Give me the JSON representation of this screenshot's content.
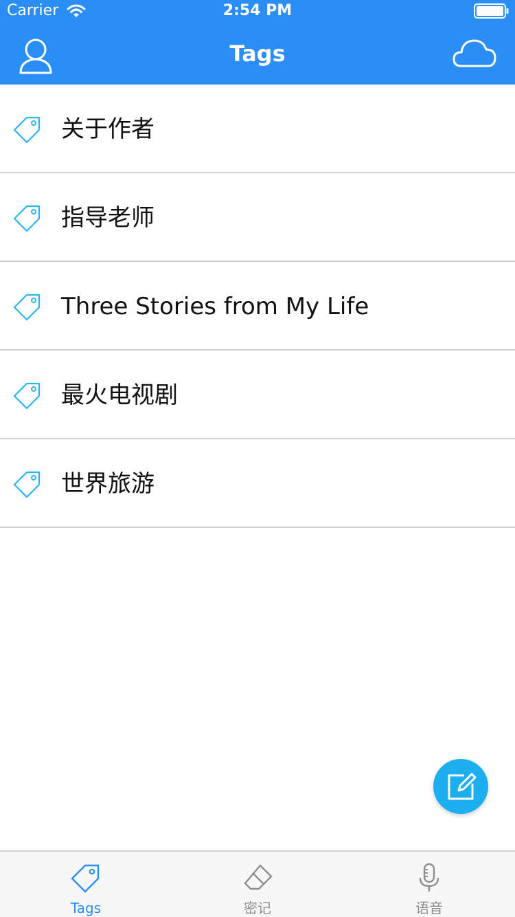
{
  "status_bar": {
    "carrier": "Carrier",
    "time": "2:54 PM",
    "wifi_icon": "wifi-icon",
    "battery_icon": "battery-icon"
  },
  "nav": {
    "title": "Tags",
    "left_icon": "user-icon",
    "right_icon": "cloud-icon"
  },
  "tags": [
    {
      "label": "关于作者",
      "icon": "tag-icon"
    },
    {
      "label": "指导老师",
      "icon": "tag-icon"
    },
    {
      "label": "Three Stories from My Life",
      "icon": "tag-icon"
    },
    {
      "label": "最火电视剧",
      "icon": "tag-icon"
    },
    {
      "label": "世界旅游",
      "icon": "tag-icon"
    }
  ],
  "fab": {
    "icon": "compose-icon"
  },
  "tab_bar": {
    "tabs": [
      {
        "label": "Tags",
        "icon": "tag-icon",
        "active": true
      },
      {
        "label": "密记",
        "icon": "eraser-icon",
        "active": false
      },
      {
        "label": "语音",
        "icon": "microphone-icon",
        "active": false
      }
    ]
  },
  "colors": {
    "header_background": "#2a8ef6",
    "accent": "#2a8ef6",
    "tag_icon": "#29b6f0",
    "fab_background": "#1daef0",
    "separator": "#cfcfcf",
    "inactive_tab": "#8e8e8e"
  }
}
